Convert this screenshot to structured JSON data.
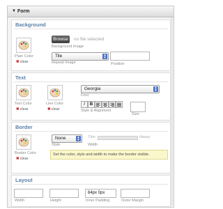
{
  "header": {
    "title": "Form"
  },
  "background": {
    "title": "Background",
    "browse_label": "Browse",
    "no_file": "no file selected",
    "image_label": "Background Image",
    "repeat_value": "Tile",
    "repeat_label": "Repeat Image",
    "position_value": "",
    "position_label": "Position",
    "color_label": "Plain Color",
    "clear_label": "clear"
  },
  "text": {
    "title": "Text",
    "text_color_label": "Text Color",
    "link_color_label": "Line Color",
    "clear_label": "clear",
    "font_value": "Georgia",
    "font_label": "Font",
    "italic": "I",
    "bold": "B",
    "style_label": "Style & Alignment",
    "size_value": "",
    "size_label": "Size"
  },
  "border": {
    "title": "Border",
    "style_value": "None",
    "style_label": "Style",
    "thin_label": "Thin",
    "heavy_label": "Heavy",
    "width_label": "Width",
    "color_label": "Border Color",
    "clear_label": "clear",
    "note": "Set the color, style and width to make the border visible."
  },
  "layout": {
    "title": "Layout",
    "width_value": "",
    "width_label": "Width",
    "height_value": "",
    "height_label": "Height",
    "padding_value": "64px 0px",
    "padding_label": "Inner Padding",
    "margin_value": "",
    "margin_label": "Outer Margin"
  },
  "icons": {
    "collapse": "triangle-down-icon",
    "swatch": "palette-icon",
    "clear": "x-icon",
    "dropdown": "dropdown-arrows-icon"
  }
}
